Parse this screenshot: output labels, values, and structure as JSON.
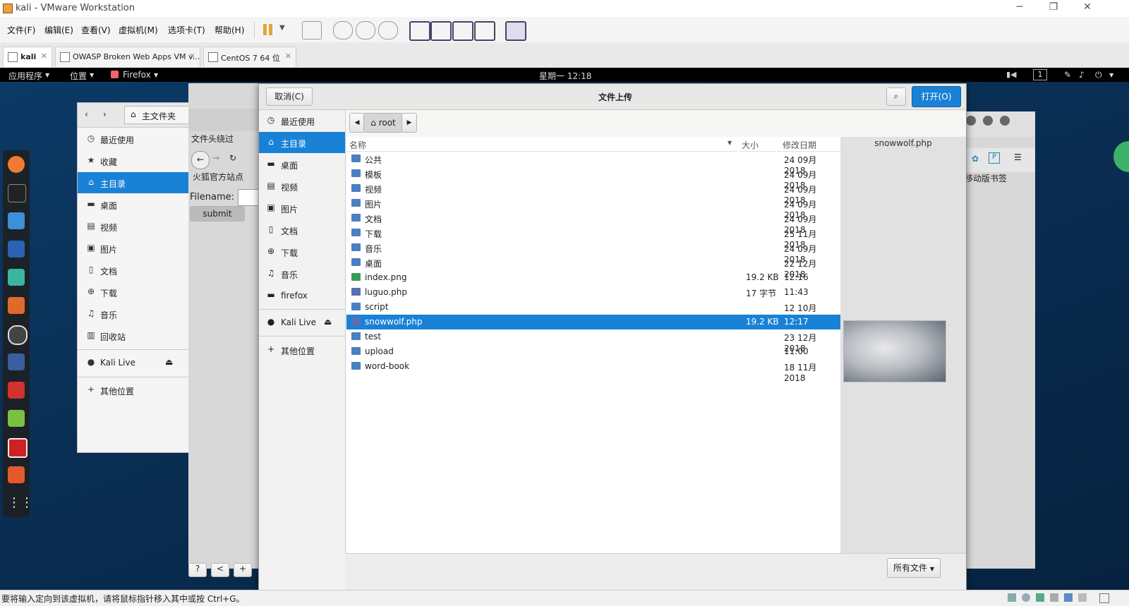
{
  "vmware": {
    "title": "kali - VMware Workstation",
    "menus": [
      "文件(F)",
      "编辑(E)",
      "查看(V)",
      "虚拟机(M)",
      "选项卡(T)",
      "帮助(H)"
    ],
    "tabs": [
      "kali",
      "OWASP Broken Web Apps VM v...",
      "CentOS 7 64 位"
    ],
    "status_text": "要将输入定向到该虚拟机，请将鼠标指针移入其中或按 Ctrl+G。"
  },
  "kali_topbar": {
    "apps": "应用程序",
    "places": "位置",
    "firefox": "Firefox",
    "clock": "星期一 12:18",
    "workspace": "1"
  },
  "files_window": {
    "location": "主文件夹",
    "items": [
      "最近使用",
      "收藏",
      "主目录",
      "桌面",
      "视频",
      "图片",
      "文档",
      "下载",
      "音乐",
      "回收站",
      "Kali Live",
      "其他位置"
    ]
  },
  "firefox_page": {
    "heading": "文件头绕过",
    "bookmark": "火狐官方站点",
    "filename_label": "Filename:",
    "submit": "submit",
    "mobile_bookmarks": "移动版书签",
    "bottom_buttons": [
      "?",
      "<",
      "+"
    ]
  },
  "dialog": {
    "title": "文件上传",
    "cancel": "取消(C)",
    "open": "打开(O)",
    "path_current": "root",
    "sidebar": [
      "最近使用",
      "主目录",
      "桌面",
      "视频",
      "图片",
      "文档",
      "下载",
      "音乐",
      "firefox",
      "Kali Live",
      "其他位置"
    ],
    "columns": {
      "name": "名称",
      "size": "大小",
      "modified": "修改日期"
    },
    "files": [
      {
        "name": "公共",
        "size": "",
        "modified": "24 09月 2018",
        "type": "folder"
      },
      {
        "name": "模板",
        "size": "",
        "modified": "24 09月 2018",
        "type": "folder"
      },
      {
        "name": "视频",
        "size": "",
        "modified": "24 09月 2018",
        "type": "folder"
      },
      {
        "name": "图片",
        "size": "",
        "modified": "24 09月 2018",
        "type": "folder"
      },
      {
        "name": "文档",
        "size": "",
        "modified": "24 09月 2018",
        "type": "folder"
      },
      {
        "name": "下载",
        "size": "",
        "modified": "25 11月 2018",
        "type": "folder"
      },
      {
        "name": "音乐",
        "size": "",
        "modified": "24 09月 2018",
        "type": "folder"
      },
      {
        "name": "桌面",
        "size": "",
        "modified": "22 12月 2018",
        "type": "folder"
      },
      {
        "name": "index.png",
        "size": "19.2 KB",
        "modified": "12:16",
        "type": "image"
      },
      {
        "name": "luguo.php",
        "size": "17 字节",
        "modified": "11:43",
        "type": "php"
      },
      {
        "name": "script",
        "size": "",
        "modified": "12 10月 2018",
        "type": "folder"
      },
      {
        "name": "snowwolf.php",
        "size": "19.2 KB",
        "modified": "12:17",
        "type": "php"
      },
      {
        "name": "test",
        "size": "",
        "modified": "23 12月 2018",
        "type": "folder"
      },
      {
        "name": "upload",
        "size": "",
        "modified": "11:00",
        "type": "folder"
      },
      {
        "name": "word-book",
        "size": "",
        "modified": "18 11月 2018",
        "type": "folder"
      }
    ],
    "selected_index": 11,
    "preview_name": "snowwolf.php",
    "filter": "所有文件"
  },
  "colors": {
    "selection": "#1a82d6",
    "open_button": "#1a82d6",
    "folder": "#4a7fc1"
  }
}
